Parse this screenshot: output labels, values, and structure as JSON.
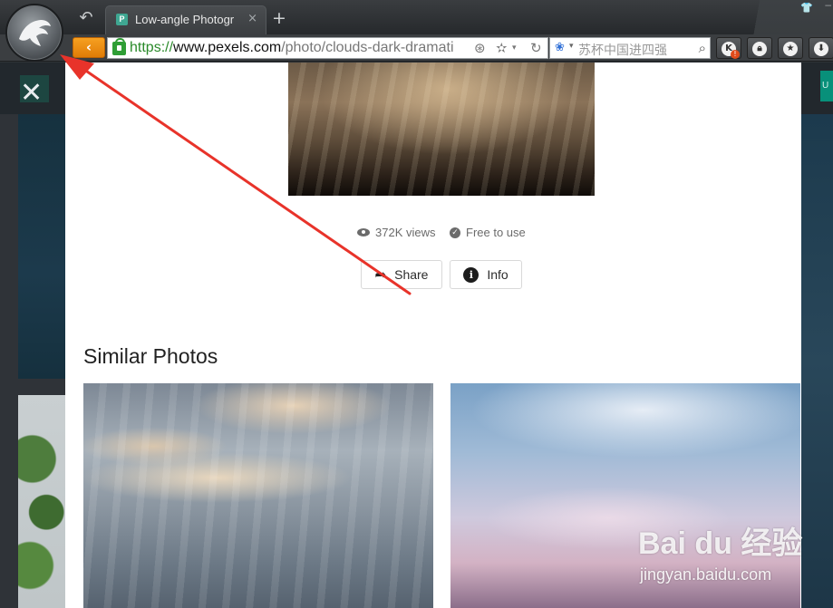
{
  "browser": {
    "tab_title": "Low-angle Photogr",
    "tab_favicon_letter": "P",
    "url_protocol": "https://",
    "url_host": "www.pexels.com",
    "url_path": "/photo/clouds-dark-dramati",
    "search_query": "苏杯中国进四强",
    "back_glyph": "‹",
    "close_tab_glyph": "×",
    "new_tab_glyph": "+",
    "toolbar_buttons": [
      {
        "name": "k-extension-icon",
        "label": "K",
        "badge": "!"
      },
      {
        "name": "lock-extension-icon",
        "label": "🔒"
      },
      {
        "name": "star-extension-icon",
        "label": "★"
      },
      {
        "name": "download-icon",
        "label": "⬇"
      }
    ]
  },
  "page": {
    "close_glyph": "✕",
    "right_chip_text": "U",
    "views": "372K views",
    "license": "Free to use",
    "share_label": "Share",
    "info_label": "Info",
    "info_icon_glyph": "i",
    "similar_title": "Similar Photos"
  },
  "watermark": {
    "brand": "Bai du 经验",
    "site": "jingyan.baidu.com"
  },
  "colors": {
    "accent_orange": "#f6a021",
    "annotation_red": "#e8332a",
    "lock_green": "#2f9e35",
    "pexels_teal": "#08907a"
  }
}
